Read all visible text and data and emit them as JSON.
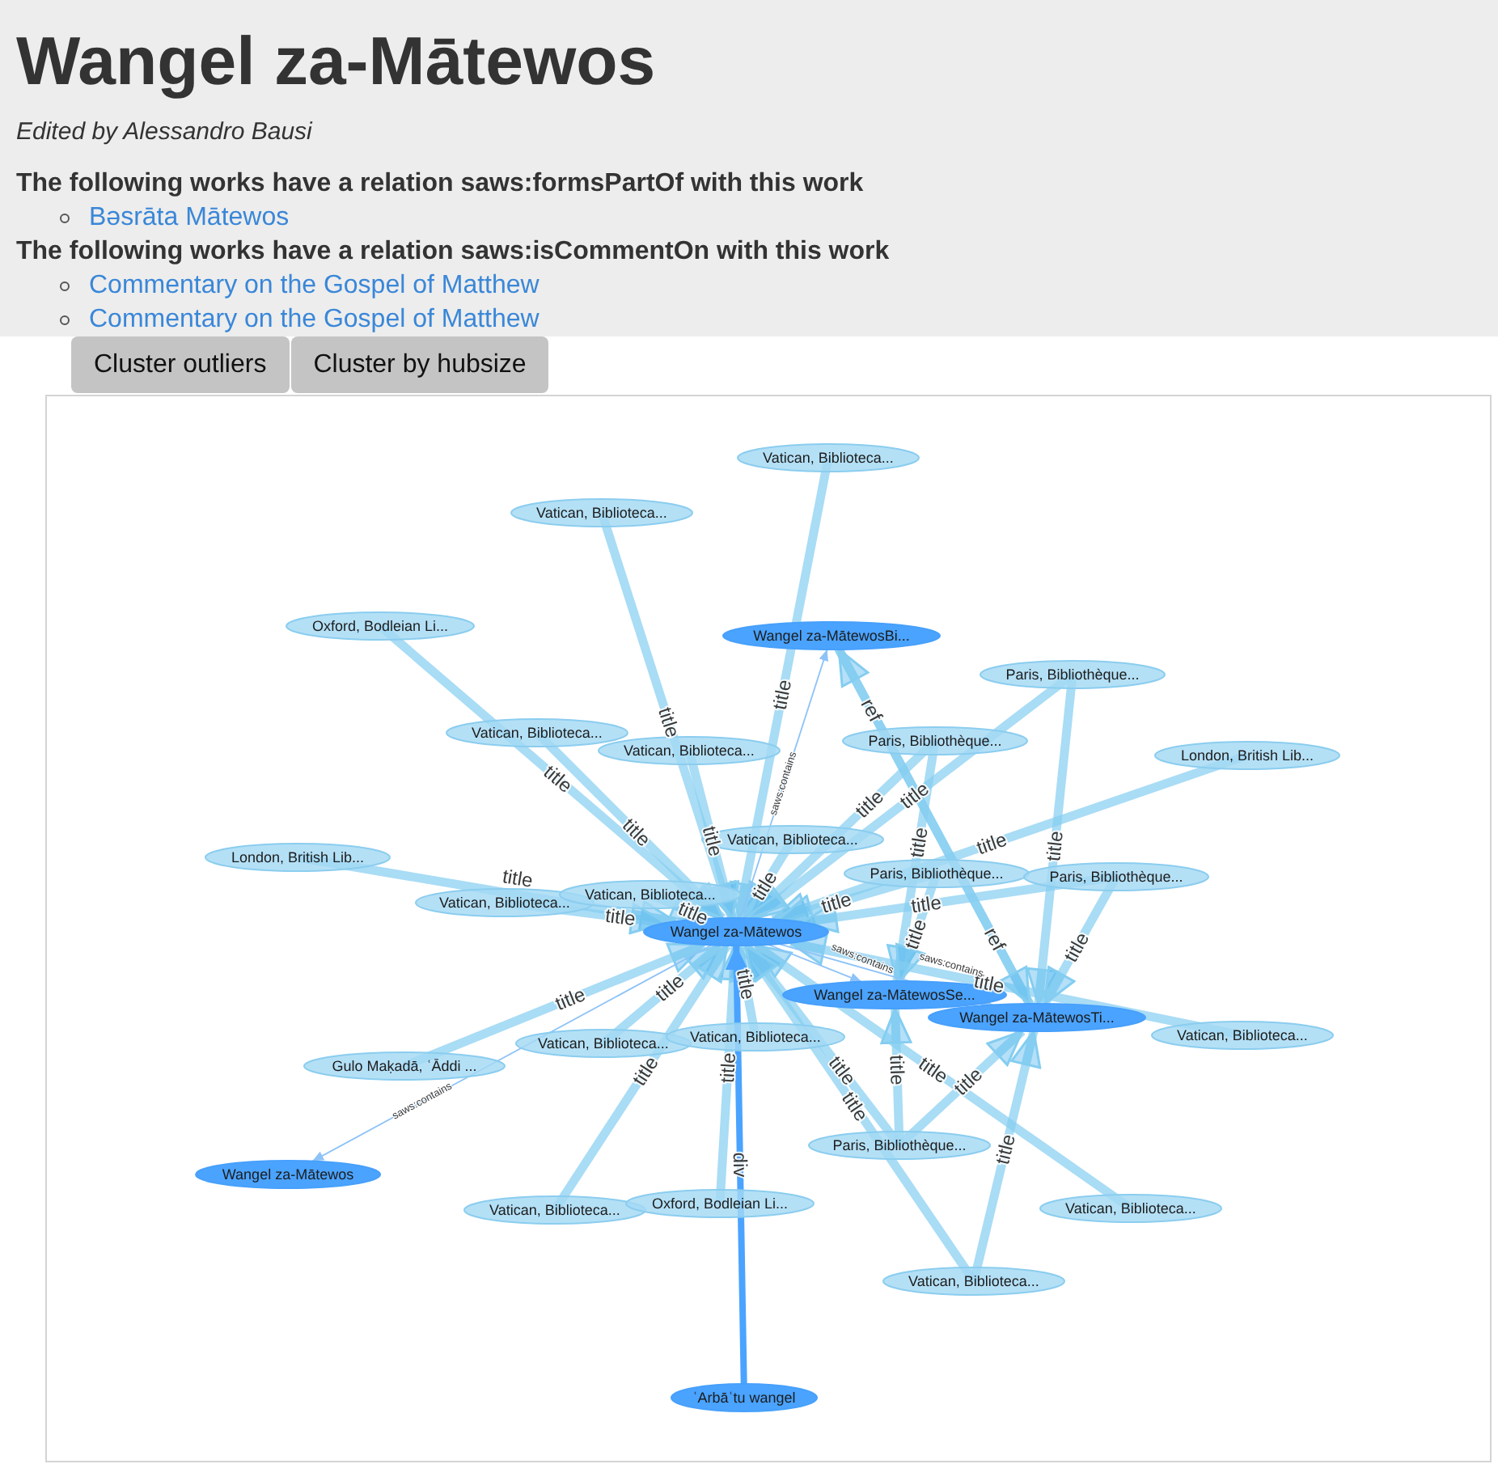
{
  "page": {
    "title": "Wangel za-Mātewos",
    "editor": "Edited by Alessandro Bausi"
  },
  "relations": [
    {
      "heading": "The following works have a relation saws:formsPartOf with this work",
      "works": [
        {
          "label": "Bəsrāta Mātewos"
        }
      ]
    },
    {
      "heading": "The following works have a relation saws:isCommentOn with this work",
      "works": [
        {
          "label": "Commentary on the Gospel of Matthew"
        },
        {
          "label": "Commentary on the Gospel of Matthew"
        }
      ]
    }
  ],
  "buttons": [
    {
      "label": "Cluster outliers"
    },
    {
      "label": "Cluster by hubsize"
    }
  ],
  "graph": {
    "nodes": [
      {
        "label": "Vatican, Biblioteca...",
        "kind": "manuscript"
      },
      {
        "label": "Vatican, Biblioteca...",
        "kind": "manuscript"
      },
      {
        "label": "Oxford, Bodleian Li...",
        "kind": "manuscript"
      },
      {
        "label": "Wangel za-MātewosBi...",
        "kind": "work"
      },
      {
        "label": "Paris, Bibliothèque...",
        "kind": "manuscript"
      },
      {
        "label": "Vatican, Biblioteca...",
        "kind": "manuscript"
      },
      {
        "label": "Vatican, Biblioteca...",
        "kind": "manuscript"
      },
      {
        "label": "Paris, Bibliothèque...",
        "kind": "manuscript"
      },
      {
        "label": "London, British Lib...",
        "kind": "manuscript"
      },
      {
        "label": "Vatican, Biblioteca...",
        "kind": "manuscript"
      },
      {
        "label": "London, British Lib...",
        "kind": "manuscript"
      },
      {
        "label": "Vatican, Biblioteca...",
        "kind": "manuscript"
      },
      {
        "label": "Vatican, Biblioteca...",
        "kind": "manuscript"
      },
      {
        "label": "Paris, Bibliothèque...",
        "kind": "manuscript"
      },
      {
        "label": "Paris, Bibliothèque...",
        "kind": "manuscript"
      },
      {
        "label": "Wangel za-Mātewos",
        "kind": "work"
      },
      {
        "label": "Wangel za-MātewosSe...",
        "kind": "work"
      },
      {
        "label": "Wangel za-MātewosTi...",
        "kind": "work"
      },
      {
        "label": "Vatican, Biblioteca...",
        "kind": "manuscript"
      },
      {
        "label": "Gulo Maḳadā, ʿĀddi ...",
        "kind": "manuscript"
      },
      {
        "label": "Vatican, Biblioteca...",
        "kind": "manuscript"
      },
      {
        "label": "Vatican, Biblioteca...",
        "kind": "manuscript"
      },
      {
        "label": "Paris, Bibliothèque...",
        "kind": "manuscript"
      },
      {
        "label": "Wangel za-Mātewos",
        "kind": "work"
      },
      {
        "label": "Vatican, Biblioteca...",
        "kind": "manuscript"
      },
      {
        "label": "Oxford, Bodleian Li...",
        "kind": "manuscript"
      },
      {
        "label": "Vatican, Biblioteca...",
        "kind": "manuscript"
      },
      {
        "label": "Vatican, Biblioteca...",
        "kind": "manuscript"
      },
      {
        "label": "ʿArbāʿtu wangel",
        "kind": "work"
      }
    ],
    "edges": [
      {
        "kind": "title",
        "label": "title"
      },
      {
        "kind": "title",
        "label": "title"
      },
      {
        "kind": "title",
        "label": "title"
      },
      {
        "kind": "title",
        "label": "title"
      },
      {
        "kind": "title",
        "label": "title"
      },
      {
        "kind": "title",
        "label": "title"
      },
      {
        "kind": "title",
        "label": "title"
      },
      {
        "kind": "title",
        "label": "title"
      },
      {
        "kind": "title",
        "label": "title"
      },
      {
        "kind": "title",
        "label": "title"
      },
      {
        "kind": "title",
        "label": "title"
      },
      {
        "kind": "title",
        "label": "title"
      },
      {
        "kind": "title",
        "label": "title"
      },
      {
        "kind": "title",
        "label": "title"
      },
      {
        "kind": "title",
        "label": "title"
      },
      {
        "kind": "title",
        "label": "title"
      },
      {
        "kind": "title",
        "label": "title"
      },
      {
        "kind": "title",
        "label": "title"
      },
      {
        "kind": "title",
        "label": "title"
      },
      {
        "kind": "title",
        "label": "title"
      },
      {
        "kind": "title",
        "label": "title"
      },
      {
        "kind": "title",
        "label": "title"
      },
      {
        "kind": "title",
        "label": "title"
      },
      {
        "kind": "title",
        "label": "title"
      },
      {
        "kind": "title",
        "label": "title"
      },
      {
        "kind": "title",
        "label": "title"
      },
      {
        "kind": "title",
        "label": "title"
      },
      {
        "kind": "title",
        "label": "title"
      },
      {
        "kind": "title",
        "label": "title"
      },
      {
        "kind": "title",
        "label": "title"
      },
      {
        "kind": "ref",
        "label": "ref"
      },
      {
        "kind": "ref",
        "label": "ref"
      },
      {
        "kind": "contains",
        "label": "saws:contains"
      },
      {
        "kind": "contains",
        "label": "saws:contains"
      },
      {
        "kind": "contains",
        "label": "saws:contains"
      },
      {
        "kind": "contains",
        "label": "saws:contains"
      },
      {
        "kind": "div",
        "label": "div"
      }
    ]
  }
}
